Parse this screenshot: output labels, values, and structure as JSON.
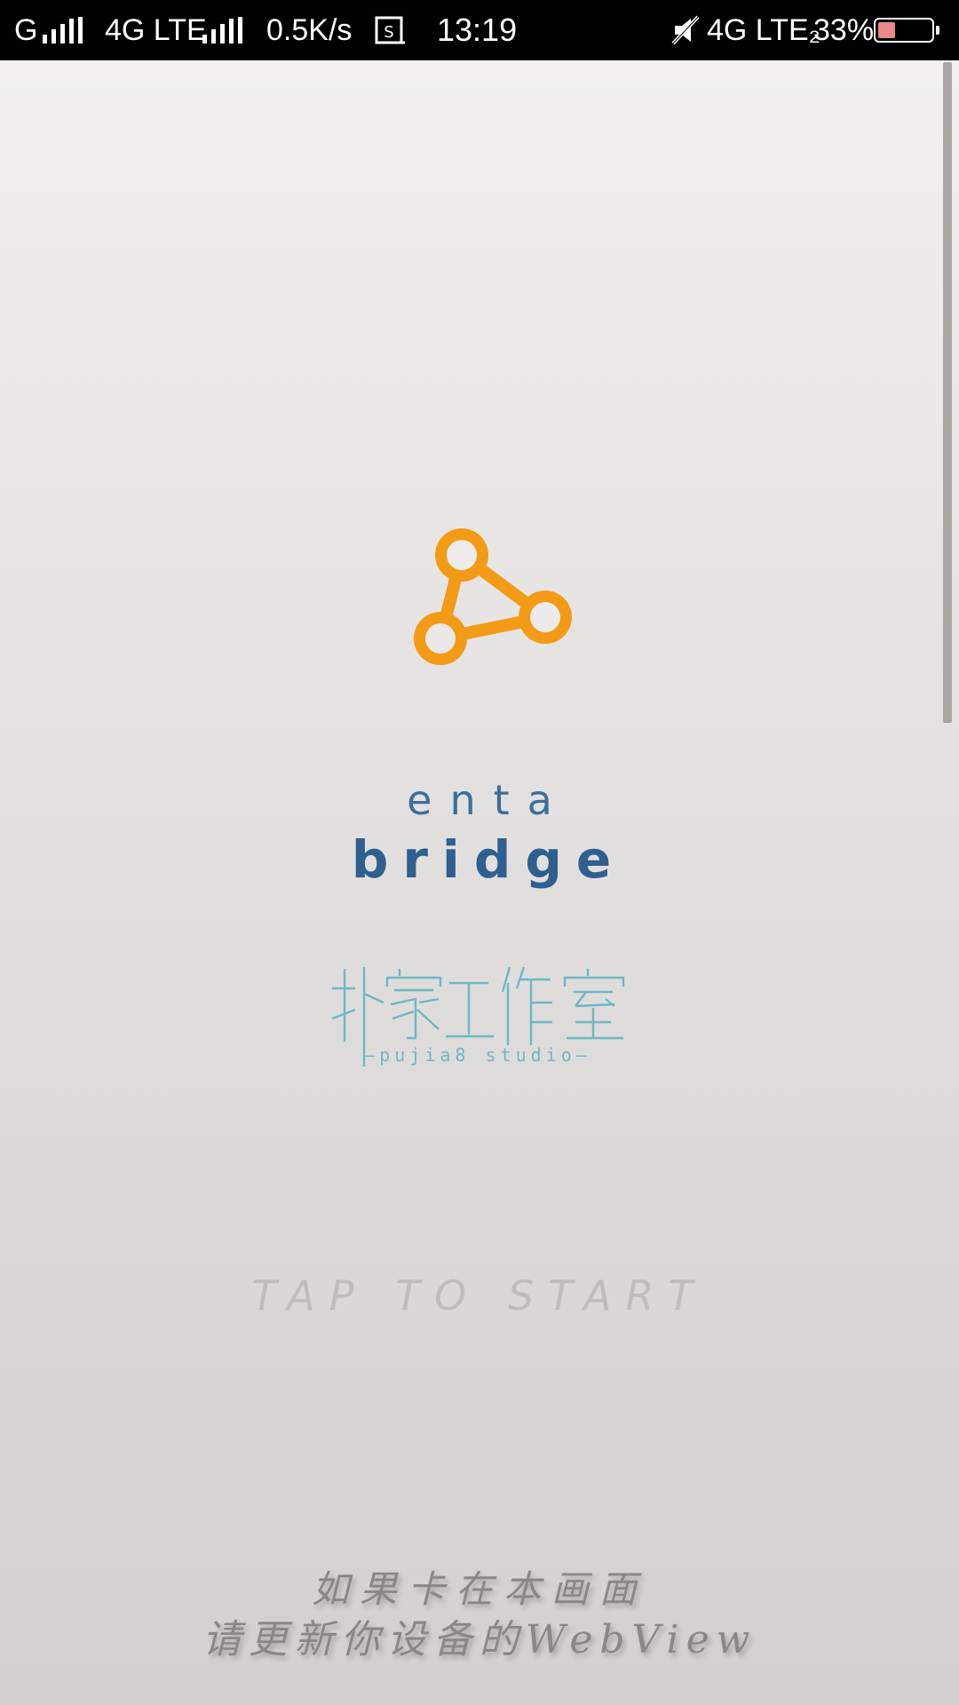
{
  "status_bar": {
    "carrier1": "G",
    "network2": "4G LTE",
    "speed": "0.5K/s",
    "time": "13:19",
    "network_right": "4G LTE₂",
    "battery_percent": "33%",
    "battery_level": 0.33,
    "icons": [
      "signal-bars-icon",
      "sim-card-icon",
      "mute-icon",
      "battery-icon"
    ]
  },
  "splash": {
    "brand_line1": "enta",
    "brand_line2": "bridge",
    "studio_name": "扑家工作室",
    "studio_subtitle": "—pujia8 studio—",
    "tap_prompt": "TAP TO START",
    "notice_line1": "如果卡在本画面",
    "notice_line2": "请更新你设备的WebView"
  },
  "colors": {
    "logo_orange": "#f39a17",
    "brand_blue": "#2f5f8f",
    "studio_teal": "#6fb7c4"
  }
}
